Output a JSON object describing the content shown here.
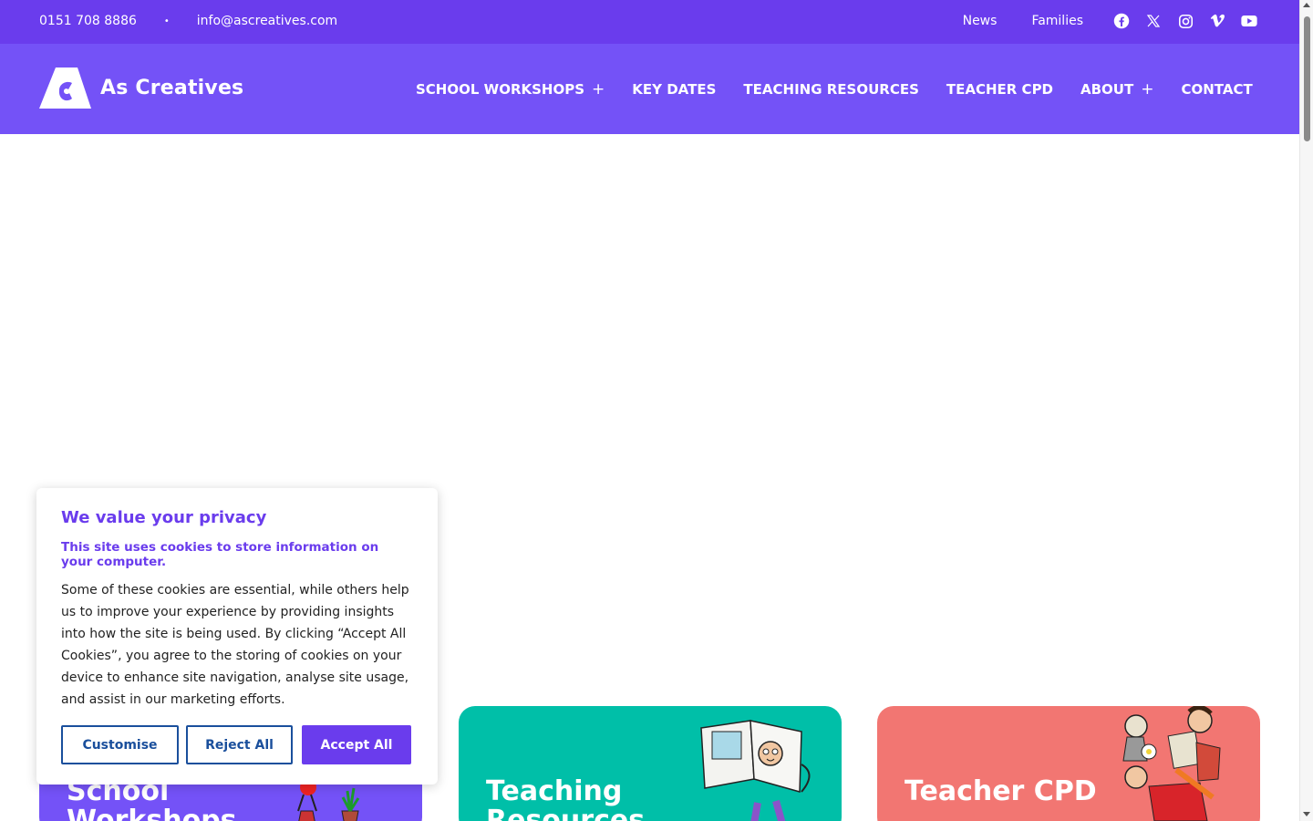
{
  "topbar": {
    "phone": "0151 708 8886",
    "separator": "•",
    "email": "info@ascreatives.com",
    "links": [
      "News",
      "Families"
    ],
    "social_icons": [
      "facebook-icon",
      "x-twitter-icon",
      "instagram-icon",
      "vimeo-icon",
      "youtube-icon"
    ]
  },
  "header": {
    "logo_text": "As Creatives",
    "nav": [
      {
        "label": "SCHOOL WORKSHOPS",
        "has_submenu": true
      },
      {
        "label": "KEY DATES",
        "has_submenu": false
      },
      {
        "label": "TEACHING RESOURCES",
        "has_submenu": false
      },
      {
        "label": "TEACHER CPD",
        "has_submenu": false
      },
      {
        "label": "ABOUT",
        "has_submenu": true
      },
      {
        "label": "CONTACT",
        "has_submenu": false
      }
    ],
    "submenu_marker": "+"
  },
  "cards": [
    {
      "title": "School Workshops",
      "color": "#7452f7"
    },
    {
      "title": "Teaching Resources",
      "color": "#00bfa8"
    },
    {
      "title": "Teacher CPD",
      "color": "#f27672"
    }
  ],
  "cookie_banner": {
    "heading": "We value your privacy",
    "subheading": "This site uses cookies to store information on your computer.",
    "body": "Some of these cookies are essential, while others help us to improve your experience by providing insights into how the site is being used. By clicking “Accept All Cookies”, you agree to the storing of cookies on your device to enhance site navigation, analyse site usage, and assist in our marketing efforts.",
    "buttons": {
      "customise": "Customise",
      "reject": "Reject All",
      "accept": "Accept All"
    }
  },
  "colors": {
    "topbar": "#6a3ced",
    "header": "#7452f7",
    "accent_text": "#6a3ced",
    "button_outline": "#1a4f9c"
  }
}
